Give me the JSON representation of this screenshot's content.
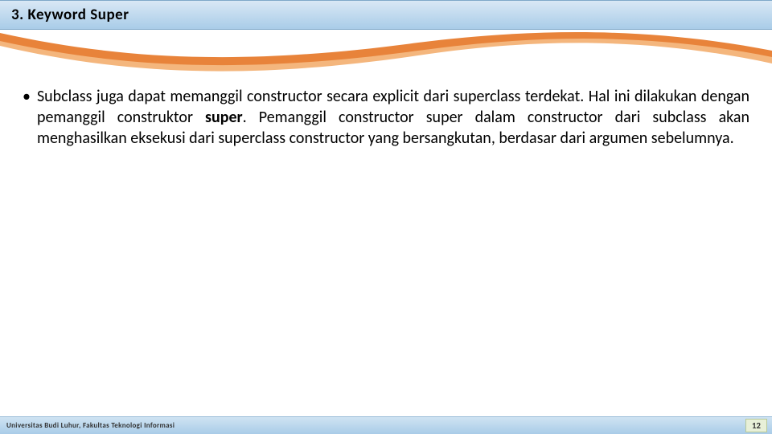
{
  "header": {
    "title": "3.  Keyword Super"
  },
  "content": {
    "p1a": "Subclass juga dapat memanggil constructor secara explicit dari superclass terdekat. Hal ini dilakukan dengan pemanggil construktor ",
    "bold": "super",
    "p1b": ". Pemanggil constructor super dalam constructor dari subclass akan menghasilkan eksekusi dari superclass constructor yang bersangkutan, berdasar dari argumen sebelumnya."
  },
  "footer": {
    "org": "Universitas Budi Luhur, Fakultas Teknologi Informasi",
    "page": "12"
  },
  "colors": {
    "wave": "#e8833a",
    "waveLight": "#f4b67d"
  }
}
